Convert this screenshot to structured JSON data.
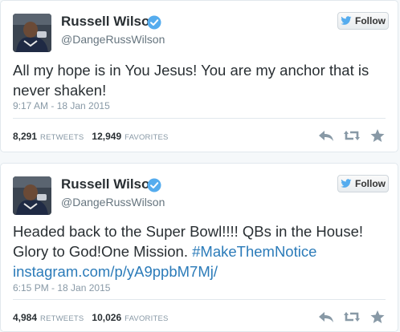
{
  "tweets": [
    {
      "name": "Russell Wilson",
      "handle": "@DangeRussWilson",
      "follow_label": "Follow",
      "text_lines": [
        "All my hope is in You Jesus! You are my anchor that is",
        "never shaken!"
      ],
      "time": "9:17 AM - 18 Jan 2015",
      "retweets": "8,291",
      "retweets_label": "RETWEETS",
      "favorites": "12,949",
      "favorites_label": "FAVORITES"
    },
    {
      "name": "Russell Wilson",
      "handle": "@DangeRussWilson",
      "follow_label": "Follow",
      "text_line1": "Headed back to the Super Bowl!!!! QBs in the House!",
      "text_line2_plain": "Glory to God!One Mission. ",
      "hashtag": "#MakeThemNotice",
      "link": "instagram.com/p/yA9ppbM7Mj/",
      "time": "6:15 PM - 18 Jan 2015",
      "retweets": "4,984",
      "retweets_label": "RETWEETS",
      "favorites": "10,026",
      "favorites_label": "FAVORITES"
    }
  ],
  "icons": {
    "verified": "verified-badge-icon",
    "bird": "twitter-bird-icon",
    "reply": "reply-icon",
    "retweet": "retweet-icon",
    "favorite": "star-icon"
  },
  "colors": {
    "link": "#2b7bb9",
    "verified": "#55acee",
    "bird": "#55acee",
    "action_icon": "#8899a6"
  }
}
